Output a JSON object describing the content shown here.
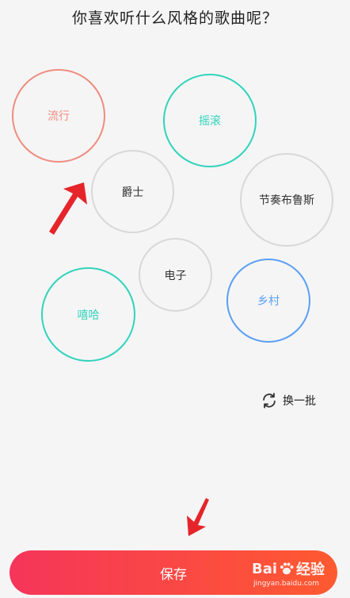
{
  "title": "你喜欢听什么风格的歌曲呢？",
  "genres": [
    {
      "label": "流行",
      "color": "#f08c80"
    },
    {
      "label": "摇滚",
      "color": "#31d3bc"
    },
    {
      "label": "爵士",
      "color": "#d8d8d8"
    },
    {
      "label": "节奏布鲁斯",
      "color": "#d8d8d8"
    },
    {
      "label": "电子",
      "color": "#d8d8d8"
    },
    {
      "label": "嘻哈",
      "color": "#31d3bc"
    },
    {
      "label": "乡村",
      "color": "#5b9ff5"
    }
  ],
  "refresh_label": "换一批",
  "save_label": "保存",
  "save_gradient": [
    "#f5355a",
    "#ff5a30"
  ],
  "annotation_arrow_color": "#e5252a",
  "watermark": {
    "brand_left": "Bai",
    "brand_right": "经验",
    "url": "jingyan.baidu.com"
  }
}
